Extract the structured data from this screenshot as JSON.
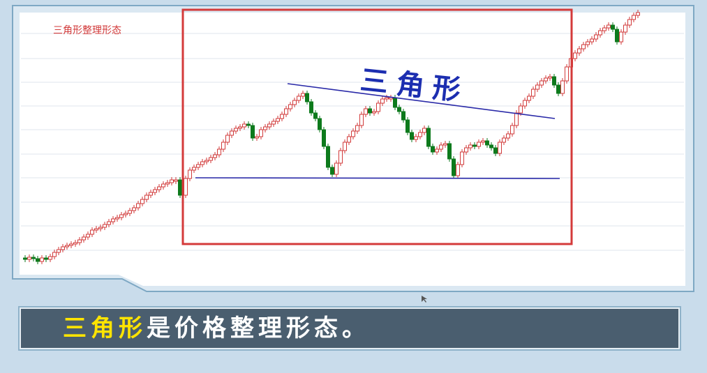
{
  "chart": {
    "corner_label": "三角形整理形态",
    "pattern_label": "三角形"
  },
  "caption": {
    "highlight": "三角形",
    "rest": "是价格整理形态。"
  },
  "colors": {
    "up": "#d23a3a",
    "down": "#0d7a1c",
    "trendline": "#2a2aa8",
    "box": "#d43a3a",
    "label_blue": "#1c2eb0"
  }
}
